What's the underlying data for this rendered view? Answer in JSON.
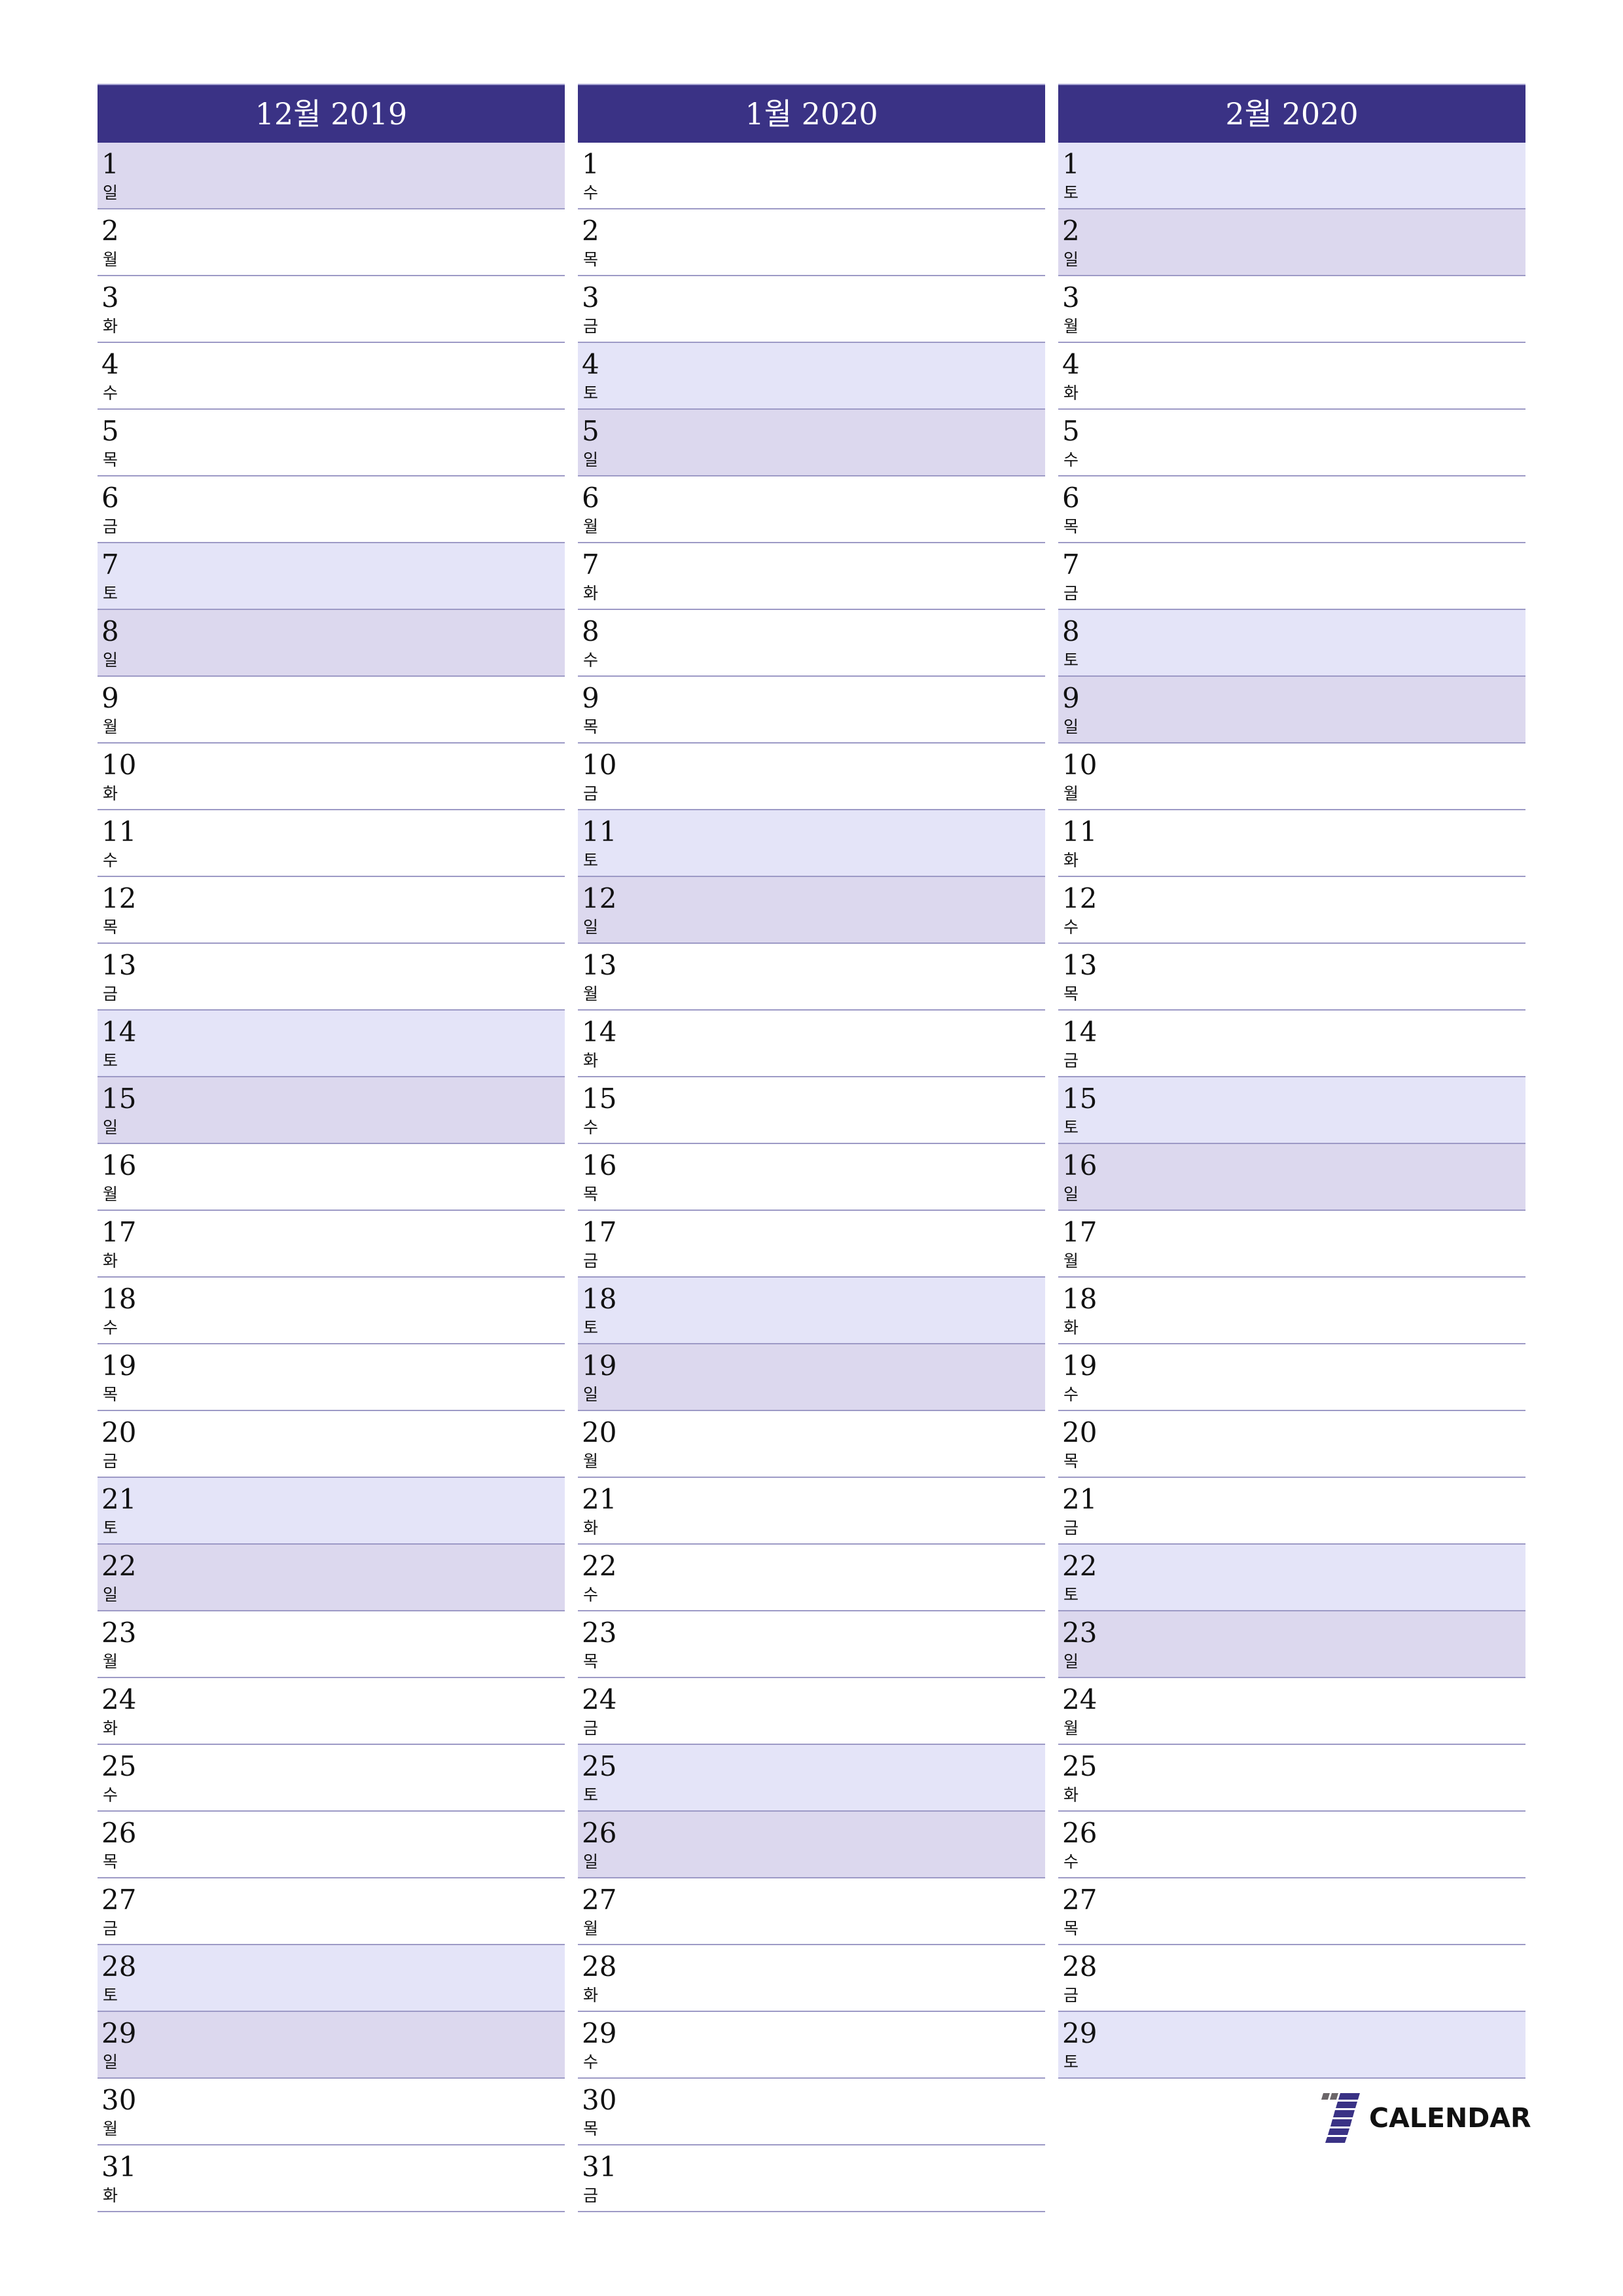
{
  "months": [
    {
      "title": "12월 2019",
      "days": [
        {
          "n": "1",
          "wd": "일",
          "type": "sun"
        },
        {
          "n": "2",
          "wd": "월",
          "type": ""
        },
        {
          "n": "3",
          "wd": "화",
          "type": ""
        },
        {
          "n": "4",
          "wd": "수",
          "type": ""
        },
        {
          "n": "5",
          "wd": "목",
          "type": ""
        },
        {
          "n": "6",
          "wd": "금",
          "type": ""
        },
        {
          "n": "7",
          "wd": "토",
          "type": "sat"
        },
        {
          "n": "8",
          "wd": "일",
          "type": "sun"
        },
        {
          "n": "9",
          "wd": "월",
          "type": ""
        },
        {
          "n": "10",
          "wd": "화",
          "type": ""
        },
        {
          "n": "11",
          "wd": "수",
          "type": ""
        },
        {
          "n": "12",
          "wd": "목",
          "type": ""
        },
        {
          "n": "13",
          "wd": "금",
          "type": ""
        },
        {
          "n": "14",
          "wd": "토",
          "type": "sat"
        },
        {
          "n": "15",
          "wd": "일",
          "type": "sun"
        },
        {
          "n": "16",
          "wd": "월",
          "type": ""
        },
        {
          "n": "17",
          "wd": "화",
          "type": ""
        },
        {
          "n": "18",
          "wd": "수",
          "type": ""
        },
        {
          "n": "19",
          "wd": "목",
          "type": ""
        },
        {
          "n": "20",
          "wd": "금",
          "type": ""
        },
        {
          "n": "21",
          "wd": "토",
          "type": "sat"
        },
        {
          "n": "22",
          "wd": "일",
          "type": "sun"
        },
        {
          "n": "23",
          "wd": "월",
          "type": ""
        },
        {
          "n": "24",
          "wd": "화",
          "type": ""
        },
        {
          "n": "25",
          "wd": "수",
          "type": ""
        },
        {
          "n": "26",
          "wd": "목",
          "type": ""
        },
        {
          "n": "27",
          "wd": "금",
          "type": ""
        },
        {
          "n": "28",
          "wd": "토",
          "type": "sat"
        },
        {
          "n": "29",
          "wd": "일",
          "type": "sun"
        },
        {
          "n": "30",
          "wd": "월",
          "type": ""
        },
        {
          "n": "31",
          "wd": "화",
          "type": ""
        }
      ]
    },
    {
      "title": "1월 2020",
      "days": [
        {
          "n": "1",
          "wd": "수",
          "type": ""
        },
        {
          "n": "2",
          "wd": "목",
          "type": ""
        },
        {
          "n": "3",
          "wd": "금",
          "type": ""
        },
        {
          "n": "4",
          "wd": "토",
          "type": "sat"
        },
        {
          "n": "5",
          "wd": "일",
          "type": "sun"
        },
        {
          "n": "6",
          "wd": "월",
          "type": ""
        },
        {
          "n": "7",
          "wd": "화",
          "type": ""
        },
        {
          "n": "8",
          "wd": "수",
          "type": ""
        },
        {
          "n": "9",
          "wd": "목",
          "type": ""
        },
        {
          "n": "10",
          "wd": "금",
          "type": ""
        },
        {
          "n": "11",
          "wd": "토",
          "type": "sat"
        },
        {
          "n": "12",
          "wd": "일",
          "type": "sun"
        },
        {
          "n": "13",
          "wd": "월",
          "type": ""
        },
        {
          "n": "14",
          "wd": "화",
          "type": ""
        },
        {
          "n": "15",
          "wd": "수",
          "type": ""
        },
        {
          "n": "16",
          "wd": "목",
          "type": ""
        },
        {
          "n": "17",
          "wd": "금",
          "type": ""
        },
        {
          "n": "18",
          "wd": "토",
          "type": "sat"
        },
        {
          "n": "19",
          "wd": "일",
          "type": "sun"
        },
        {
          "n": "20",
          "wd": "월",
          "type": ""
        },
        {
          "n": "21",
          "wd": "화",
          "type": ""
        },
        {
          "n": "22",
          "wd": "수",
          "type": ""
        },
        {
          "n": "23",
          "wd": "목",
          "type": ""
        },
        {
          "n": "24",
          "wd": "금",
          "type": ""
        },
        {
          "n": "25",
          "wd": "토",
          "type": "sat"
        },
        {
          "n": "26",
          "wd": "일",
          "type": "sun"
        },
        {
          "n": "27",
          "wd": "월",
          "type": ""
        },
        {
          "n": "28",
          "wd": "화",
          "type": ""
        },
        {
          "n": "29",
          "wd": "수",
          "type": ""
        },
        {
          "n": "30",
          "wd": "목",
          "type": ""
        },
        {
          "n": "31",
          "wd": "금",
          "type": ""
        }
      ]
    },
    {
      "title": "2월 2020",
      "days": [
        {
          "n": "1",
          "wd": "토",
          "type": "sat"
        },
        {
          "n": "2",
          "wd": "일",
          "type": "sun"
        },
        {
          "n": "3",
          "wd": "월",
          "type": ""
        },
        {
          "n": "4",
          "wd": "화",
          "type": ""
        },
        {
          "n": "5",
          "wd": "수",
          "type": ""
        },
        {
          "n": "6",
          "wd": "목",
          "type": ""
        },
        {
          "n": "7",
          "wd": "금",
          "type": ""
        },
        {
          "n": "8",
          "wd": "토",
          "type": "sat"
        },
        {
          "n": "9",
          "wd": "일",
          "type": "sun"
        },
        {
          "n": "10",
          "wd": "월",
          "type": ""
        },
        {
          "n": "11",
          "wd": "화",
          "type": ""
        },
        {
          "n": "12",
          "wd": "수",
          "type": ""
        },
        {
          "n": "13",
          "wd": "목",
          "type": ""
        },
        {
          "n": "14",
          "wd": "금",
          "type": ""
        },
        {
          "n": "15",
          "wd": "토",
          "type": "sat"
        },
        {
          "n": "16",
          "wd": "일",
          "type": "sun"
        },
        {
          "n": "17",
          "wd": "월",
          "type": ""
        },
        {
          "n": "18",
          "wd": "화",
          "type": ""
        },
        {
          "n": "19",
          "wd": "수",
          "type": ""
        },
        {
          "n": "20",
          "wd": "목",
          "type": ""
        },
        {
          "n": "21",
          "wd": "금",
          "type": ""
        },
        {
          "n": "22",
          "wd": "토",
          "type": "sat"
        },
        {
          "n": "23",
          "wd": "일",
          "type": "sun"
        },
        {
          "n": "24",
          "wd": "월",
          "type": ""
        },
        {
          "n": "25",
          "wd": "화",
          "type": ""
        },
        {
          "n": "26",
          "wd": "수",
          "type": ""
        },
        {
          "n": "27",
          "wd": "목",
          "type": ""
        },
        {
          "n": "28",
          "wd": "금",
          "type": ""
        },
        {
          "n": "29",
          "wd": "토",
          "type": "sat"
        }
      ]
    }
  ],
  "colors": {
    "header": "#3a3285",
    "saturday": "#e4e4f8",
    "sunday": "#dcd8ee",
    "divider": "#9d9ac6"
  },
  "logo": {
    "icon": "seven-icon",
    "text": "CALENDAR"
  }
}
